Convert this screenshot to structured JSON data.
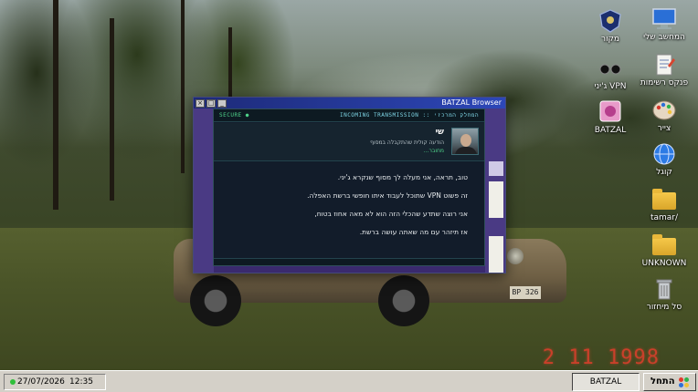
{
  "desktop": {
    "photo_date": "2 11 1998",
    "car_plate": "BP 326",
    "icons": [
      {
        "label": "המחשב שלי",
        "icon": "monitor-icon"
      },
      {
        "label": "מקור",
        "icon": "emblem-icon"
      },
      {
        "label": "פנקס רשימות",
        "icon": "notepad-icon"
      },
      {
        "label": "ג'יני VPN",
        "icon": "vpn-glasses-icon"
      },
      {
        "label": "צייר",
        "icon": "paint-palette-icon"
      },
      {
        "label": "BATZAL",
        "icon": "batzal-icon"
      },
      {
        "label": "קוגל",
        "icon": "globe-icon"
      },
      {
        "label": "tamar/",
        "icon": "folder-icon"
      },
      {
        "label": "UNKNOWN",
        "icon": "folder-icon"
      },
      {
        "label": "סל מיחזור",
        "icon": "recycle-bin-icon"
      }
    ]
  },
  "browser": {
    "title": "BATZAL Browser",
    "buttons": [
      "×",
      "□",
      "_"
    ]
  },
  "message": {
    "secure_label": "SECURE ●",
    "header_label": "INCOMING TRANSMISSION :: המחלק המרכזי",
    "sender_name": "שי",
    "sender_subtitle": "הודעה קולית שהתקבלה במסוף",
    "sender_status": "מחובר...",
    "lines": [
      "טוב, תראה, אני מעלה לך מסוף שנקרא ג'יני.",
      "זה פשוט VPN שתוכל לעבוד איתו חופשי ברשת האפלה.",
      "אני רוצה שתדע שהכלי הזה הוא לא מאה אחוז בטוח,",
      "אז תיזהר עם מה שאתה עושה ברשת."
    ]
  },
  "taskbar": {
    "start_label": "התחל",
    "task_label": "BATZAL Browser",
    "date": "27/07/2026",
    "time": "12:35 AM"
  },
  "colors": {
    "accent_green": "#4fd38a",
    "accent_cyan": "#7fd6e6",
    "title_blue": "#2d47b8"
  }
}
